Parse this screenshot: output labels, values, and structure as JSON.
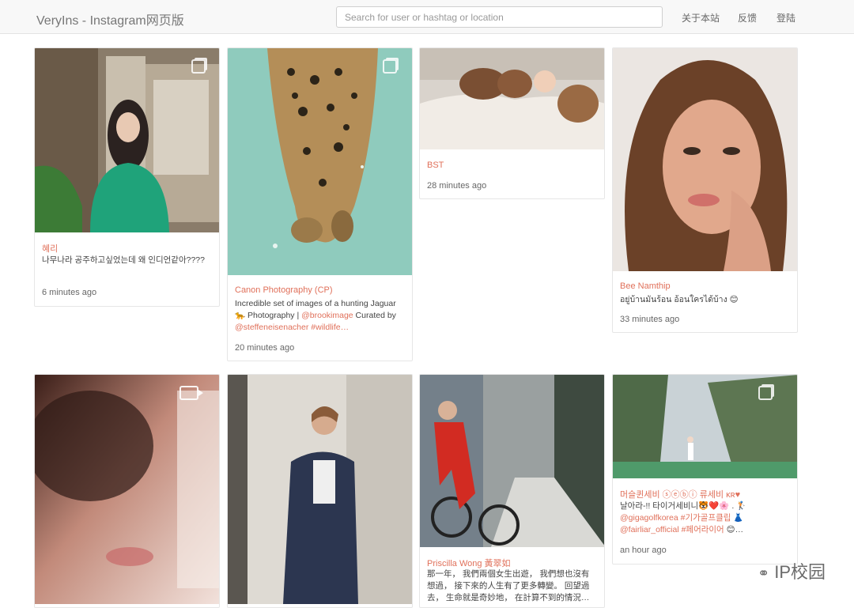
{
  "navbar": {
    "brand": "VeryIns - Instagram网页版",
    "search_placeholder": "Search for user or hashtag or location",
    "links": [
      "关于本站",
      "反馈",
      "登陆"
    ]
  },
  "posts": [
    {
      "author": "혜리",
      "caption": "나무나라 공주하고싶었는데 왜 인디언같아????",
      "time": "6 minutes ago",
      "icon": "multi-photo-icon"
    },
    {
      "author": "Canon Photography (CP)",
      "caption_parts": [
        "Incredible set of images of a hunting Jaguar 🐆 Photography | ",
        "@brookimage",
        " Curated by ",
        "@steffeneisenacher #wildlife…"
      ],
      "time": "20 minutes ago",
      "icon": "multi-photo-icon"
    },
    {
      "author": "BST",
      "time": "28 minutes ago"
    },
    {
      "author": "Bee Namthip",
      "caption": "อยู่บ้านมันร้อน อ้อนใครได้บ้าง 😊",
      "time": "33 minutes ago"
    },
    {
      "icon": "video-icon"
    },
    {},
    {
      "author": "Priscilla Wong 黃翠如",
      "caption": "那一年， 我們兩個女生出遊， 我們想也沒有想過， 接下來的人生有了更多轉變。 回望過去， 生命就是奇妙地， 在計算不到的情況…"
    },
    {
      "author": "머슬퀸세비 ⓢⓔⓑⓘ 류세비 ᴋʀ♥",
      "caption_parts": [
        "날아라-!! 타이거세비니🐯❤️🌸 . 🏌 ",
        "@gigagolfkorea #기가골프클립",
        " 👗 ",
        "@fairliar_official #페어라이어",
        " 😊…"
      ],
      "time": "an hour ago",
      "icon": "multi-photo-icon"
    }
  ],
  "watermark": "IP校园",
  "colors": {
    "accent": "#e0705a",
    "navbar_bg": "#f8f8f8"
  }
}
